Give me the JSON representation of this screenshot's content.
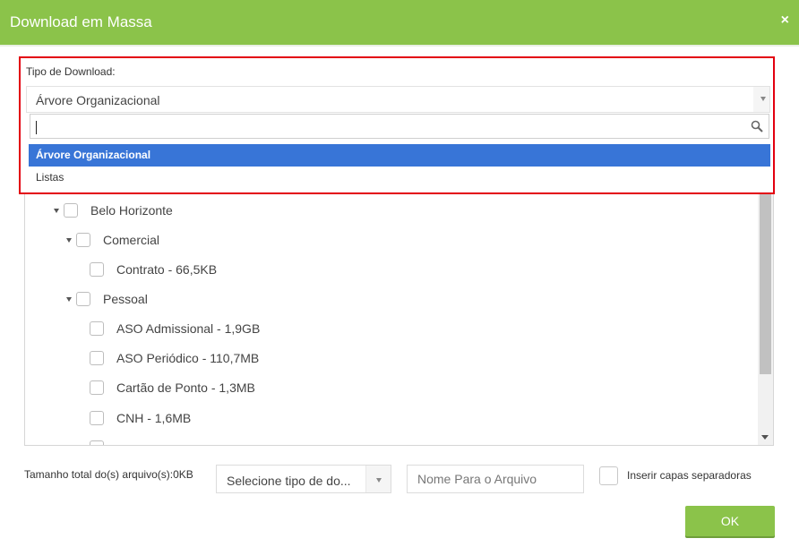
{
  "header": {
    "title": "Download em Massa",
    "close_symbol": "×"
  },
  "download_type": {
    "label": "Tipo de Download:",
    "selected_value": "Árvore Organizacional",
    "search_value": "",
    "options": [
      {
        "label": "Árvore Organizacional",
        "selected": true
      },
      {
        "label": "Listas",
        "selected": false
      }
    ]
  },
  "tree": {
    "nodes": [
      {
        "label": "Belo Horizonte",
        "level": 0,
        "expandable": true
      },
      {
        "label": "Comercial",
        "level": 1,
        "expandable": true
      },
      {
        "label": "Contrato - 66,5KB",
        "level": 2,
        "expandable": false
      },
      {
        "label": "Pessoal",
        "level": 1,
        "expandable": true
      },
      {
        "label": "ASO Admissional - 1,9GB",
        "level": 2,
        "expandable": false
      },
      {
        "label": "ASO Periódico - 110,7MB",
        "level": 2,
        "expandable": false
      },
      {
        "label": "Cartão de Ponto - 1,3MB",
        "level": 2,
        "expandable": false
      },
      {
        "label": "CNH - 1,6MB",
        "level": 2,
        "expandable": false
      }
    ]
  },
  "footer": {
    "total_size_label": "Tamanho total do(s) arquivo(s):0KB",
    "type_select_placeholder": "Selecione tipo de do...",
    "filename_placeholder": "Nome Para o Arquivo",
    "cover_label": "Inserir capas separadoras",
    "ok_label": "OK"
  },
  "colors": {
    "header": "#8bc34a",
    "highlight": "#3875d7",
    "frame": "#e3000f"
  }
}
